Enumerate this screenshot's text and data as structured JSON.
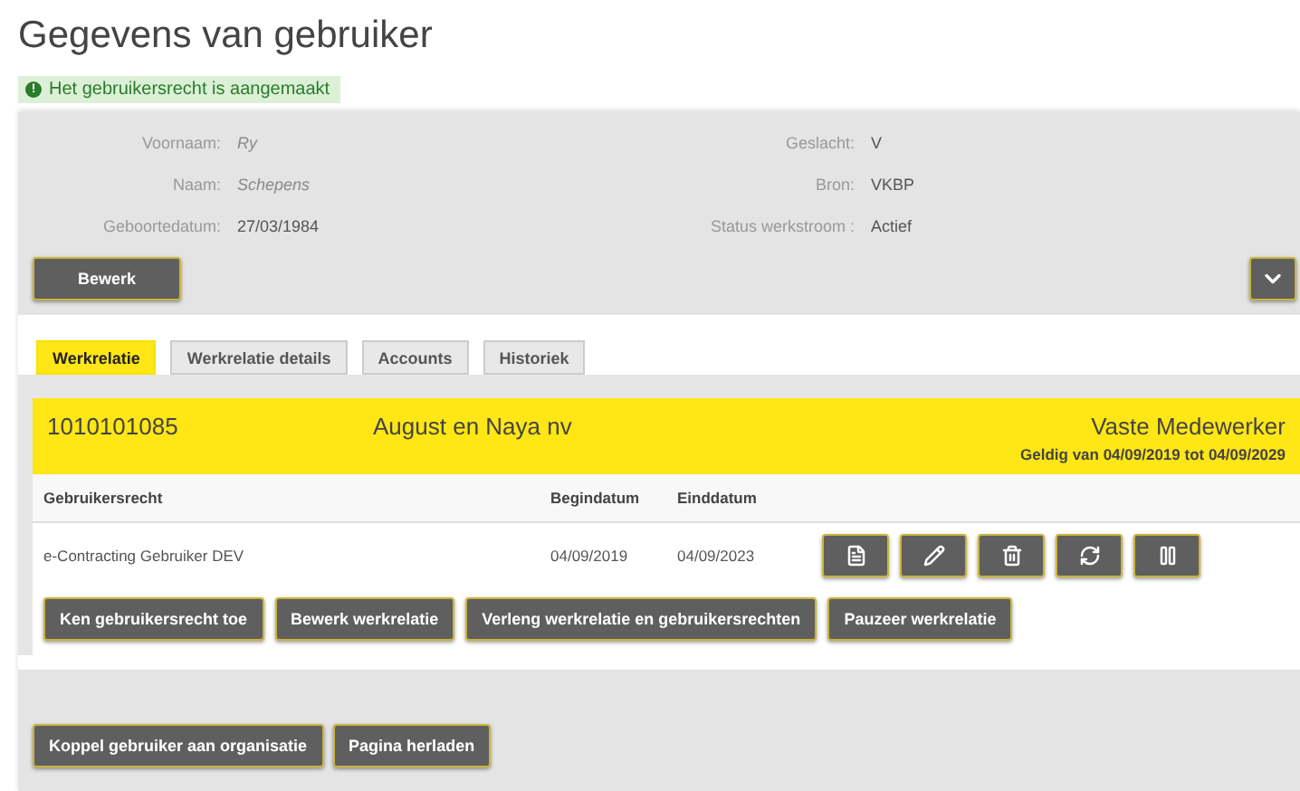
{
  "page": {
    "title": "Gegevens van gebruiker"
  },
  "alert": {
    "icon": "!",
    "text": "Het gebruikersrecht is aangemaakt"
  },
  "user": {
    "left": [
      {
        "label": "Voornaam:",
        "value": "Ry",
        "blurred": true
      },
      {
        "label": "Naam:",
        "value": "Schepens",
        "blurred": true
      },
      {
        "label": "Geboortedatum:",
        "value": "27/03/1984",
        "blurred": false
      }
    ],
    "right": [
      {
        "label": "Geslacht:",
        "value": "V",
        "blurred": false
      },
      {
        "label": "Bron:",
        "value": "VKBP",
        "blurred": false
      },
      {
        "label": "Status werkstroom :",
        "value": "Actief",
        "blurred": false
      }
    ],
    "edit_button": "Bewerk",
    "expanded": false
  },
  "tabs": [
    {
      "label": "Werkrelatie",
      "selected": true
    },
    {
      "label": "Werkrelatie details",
      "selected": false
    },
    {
      "label": "Accounts",
      "selected": false
    },
    {
      "label": "Historiek",
      "selected": false
    }
  ],
  "relation": {
    "number": "1010101085",
    "organisation": "August en Naya nv",
    "role": "Vaste Medewerker",
    "validity": "Geldig van 04/09/2019 tot 04/09/2029"
  },
  "table": {
    "columns": [
      "Gebruikersrecht",
      "Begindatum",
      "Einddatum"
    ],
    "rows": [
      {
        "cells": [
          "e-Contracting Gebruiker DEV",
          "04/09/2019",
          "04/09/2023"
        ],
        "actions": [
          {
            "kind": "document"
          },
          {
            "kind": "edit"
          },
          {
            "kind": "delete"
          },
          {
            "kind": "renew"
          },
          {
            "kind": "pause"
          }
        ]
      }
    ]
  },
  "relation_buttons": [
    "Ken gebruikersrecht toe",
    "Bewerk werkrelatie",
    "Verleng werkrelatie en gebruikersrechten",
    "Pauzeer werkrelatie"
  ],
  "footer_buttons": [
    "Koppel gebruiker aan organisatie",
    "Pagina herladen"
  ]
}
